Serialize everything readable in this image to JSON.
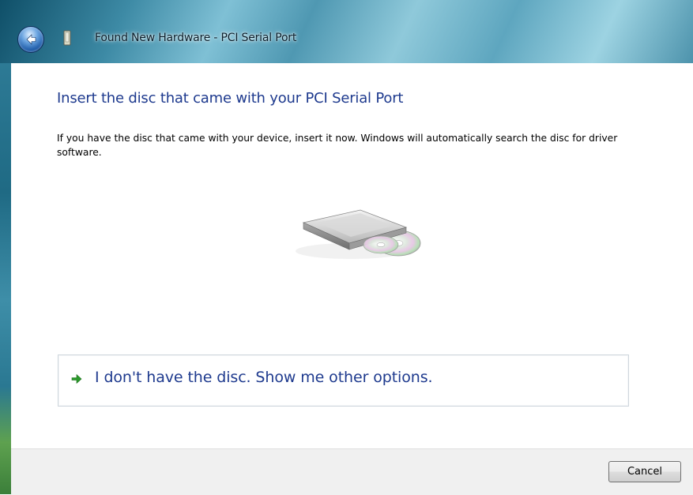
{
  "window": {
    "title": "Found New Hardware - PCI Serial Port",
    "icons": {
      "back": "back-arrow-icon",
      "device": "hardware-device-icon"
    }
  },
  "main": {
    "instruction": "Insert the disc that came with your PCI Serial Port",
    "description": "If you have the disc that came with your device, insert it now.  Windows will automatically search the disc for driver software.",
    "illustration": "disc-drive-illustration"
  },
  "option": {
    "label": "I don't have the disc.  Show me other options.",
    "icon": "green-arrow-icon"
  },
  "footer": {
    "cancel_label": "Cancel"
  },
  "colors": {
    "heading": "#1e3a8e",
    "arrow": "#2a9a2a",
    "footer_bg": "#f0f0f0"
  }
}
